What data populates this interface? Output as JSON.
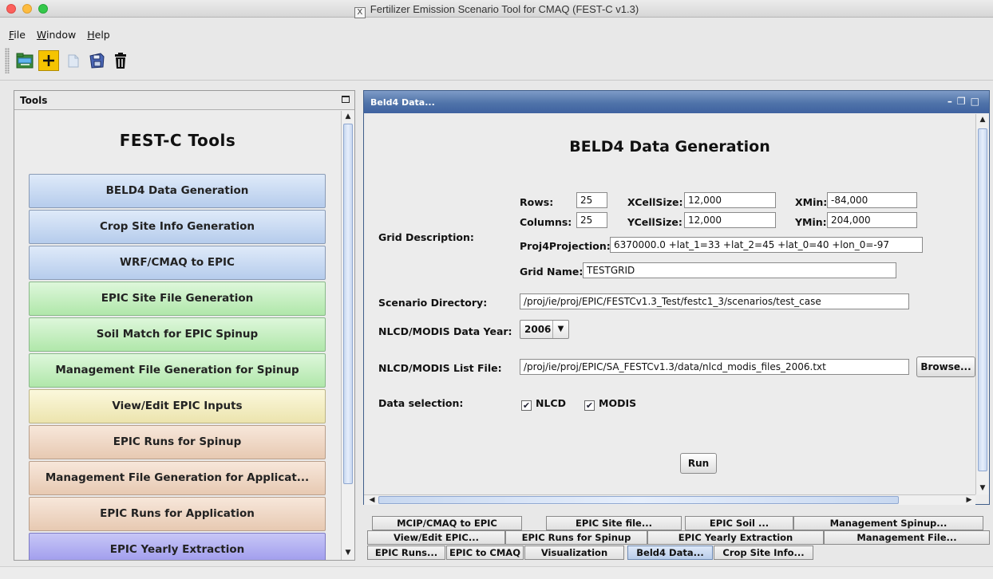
{
  "window": {
    "title": "Fertilizer Emission Scenario Tool for CMAQ (FEST-C v1.3)"
  },
  "menu": [
    "File",
    "Window",
    "Help"
  ],
  "toolbar": {
    "buttons": [
      "open-folder-icon",
      "add-icon",
      "copy-icon",
      "save-icon",
      "trash-icon"
    ]
  },
  "tools_panel": {
    "header": "Tools",
    "title": "FEST-C Tools",
    "buttons": [
      {
        "label": "BELD4 Data Generation",
        "color": "#c8d9f2"
      },
      {
        "label": "Crop Site Info Generation",
        "color": "#c8d9f2"
      },
      {
        "label": "WRF/CMAQ to EPIC",
        "color": "#c8d9f2"
      },
      {
        "label": "EPIC Site File Generation",
        "color": "#c6f0c0"
      },
      {
        "label": "Soil Match for EPIC Spinup",
        "color": "#c6f0c0"
      },
      {
        "label": "Management File Generation for Spinup",
        "color": "#c6f0c0"
      },
      {
        "label": "View/Edit EPIC Inputs",
        "color": "#f5efc3"
      },
      {
        "label": "EPIC Runs for Spinup",
        "color": "#efd8c6"
      },
      {
        "label": "Management File Generation for Applicat...",
        "color": "#efd8c6"
      },
      {
        "label": "EPIC Runs for Application",
        "color": "#efd8c6"
      },
      {
        "label": "EPIC Yearly Extraction",
        "color": "#b0aef1"
      }
    ]
  },
  "frame": {
    "title": "Beld4 Data...",
    "heading": "BELD4 Data Generation",
    "grid": {
      "section_label": "Grid Description:",
      "rows_label": "Rows:",
      "rows": "25",
      "columns_label": "Columns:",
      "columns": "25",
      "xcellsize_label": "XCellSize:",
      "xcellsize": "12,000",
      "ycellsize_label": "YCellSize:",
      "ycellsize": "12,000",
      "xmin_label": "XMin:",
      "xmin": "-84,000",
      "ymin_label": "YMin:",
      "ymin": "204,000",
      "proj_label": "Proj4Projection:",
      "proj": "6370000.0 +lat_1=33 +lat_2=45 +lat_0=40 +lon_0=-97",
      "name_label": "Grid Name:",
      "name": "TESTGRID"
    },
    "scenario_label": "Scenario Directory:",
    "scenario_dir": "/proj/ie/proj/EPIC/FESTCv1.3_Test/festc1_3/scenarios/test_case",
    "year_label": "NLCD/MODIS Data Year:",
    "year": "2006",
    "list_label": "NLCD/MODIS List File:",
    "list_file": "/proj/ie/proj/EPIC/SA_FESTCv1.3/data/nlcd_modis_files_2006.txt",
    "browse": "Browse...",
    "selection_label": "Data selection:",
    "nlcd": "NLCD",
    "modis": "MODIS",
    "run": "Run"
  },
  "tabs": {
    "row1": [
      "MCIP/CMAQ to EPIC",
      "EPIC Site file...",
      "EPIC Soil ...",
      "Management Spinup..."
    ],
    "row2": [
      "View/Edit EPIC...",
      "EPIC Runs for Spinup",
      "EPIC Yearly Extraction",
      "Management File..."
    ],
    "row3": [
      "EPIC Runs...",
      "EPIC to CMAQ",
      "Visualization",
      "Beld4 Data...",
      "Crop Site Info..."
    ],
    "selected": "Beld4 Data..."
  }
}
